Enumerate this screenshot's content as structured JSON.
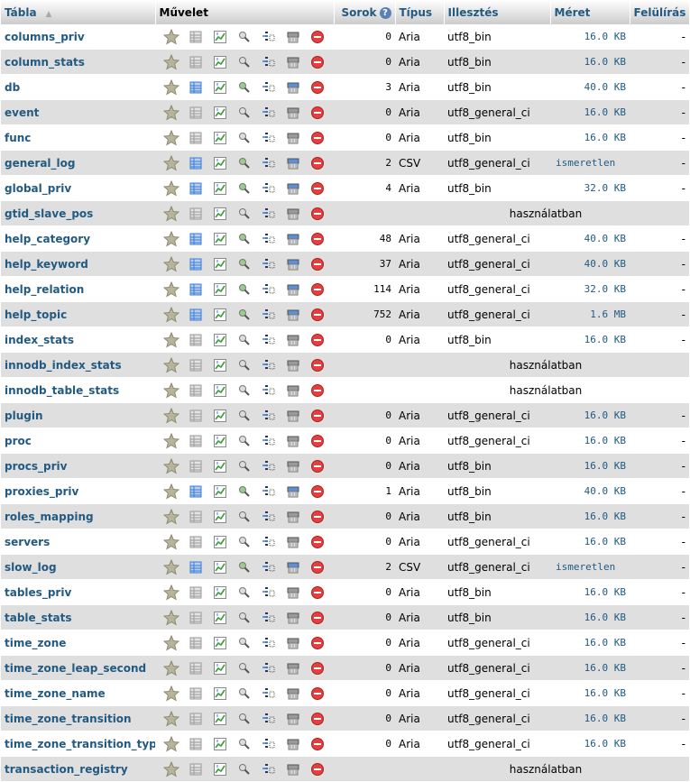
{
  "header": {
    "table": "Tábla",
    "action": "Művelet",
    "rows": "Sorok",
    "type": "Típus",
    "collation": "Illesztés",
    "size": "Méret",
    "overhead": "Felülírás"
  },
  "rows": [
    {
      "name": "columns_priv",
      "active": false,
      "rows": "0",
      "type": "Aria",
      "collation": "utf8_bin",
      "size": "16.0 KB",
      "overhead": "-"
    },
    {
      "name": "column_stats",
      "active": false,
      "rows": "0",
      "type": "Aria",
      "collation": "utf8_bin",
      "size": "16.0 KB",
      "overhead": "-"
    },
    {
      "name": "db",
      "active": true,
      "rows": "3",
      "type": "Aria",
      "collation": "utf8_bin",
      "size": "40.0 KB",
      "overhead": "-"
    },
    {
      "name": "event",
      "active": false,
      "rows": "0",
      "type": "Aria",
      "collation": "utf8_general_ci",
      "size": "16.0 KB",
      "overhead": "-"
    },
    {
      "name": "func",
      "active": false,
      "rows": "0",
      "type": "Aria",
      "collation": "utf8_bin",
      "size": "16.0 KB",
      "overhead": "-"
    },
    {
      "name": "general_log",
      "active": true,
      "rows": "2",
      "type": "CSV",
      "collation": "utf8_general_ci",
      "size": "ismeretlen",
      "overhead": "-"
    },
    {
      "name": "global_priv",
      "active": true,
      "rows": "4",
      "type": "Aria",
      "collation": "utf8_bin",
      "size": "32.0 KB",
      "overhead": "-"
    },
    {
      "name": "gtid_slave_pos",
      "active": false,
      "inuse": "használatban"
    },
    {
      "name": "help_category",
      "active": true,
      "rows": "48",
      "type": "Aria",
      "collation": "utf8_general_ci",
      "size": "40.0 KB",
      "overhead": "-"
    },
    {
      "name": "help_keyword",
      "active": true,
      "rows": "37",
      "type": "Aria",
      "collation": "utf8_general_ci",
      "size": "40.0 KB",
      "overhead": "-"
    },
    {
      "name": "help_relation",
      "active": true,
      "rows": "114",
      "type": "Aria",
      "collation": "utf8_general_ci",
      "size": "32.0 KB",
      "overhead": "-"
    },
    {
      "name": "help_topic",
      "active": true,
      "rows": "752",
      "type": "Aria",
      "collation": "utf8_general_ci",
      "size": "1.6 MB",
      "overhead": "-"
    },
    {
      "name": "index_stats",
      "active": false,
      "rows": "0",
      "type": "Aria",
      "collation": "utf8_bin",
      "size": "16.0 KB",
      "overhead": "-"
    },
    {
      "name": "innodb_index_stats",
      "active": false,
      "inuse": "használatban"
    },
    {
      "name": "innodb_table_stats",
      "active": false,
      "inuse": "használatban"
    },
    {
      "name": "plugin",
      "active": false,
      "rows": "0",
      "type": "Aria",
      "collation": "utf8_general_ci",
      "size": "16.0 KB",
      "overhead": "-"
    },
    {
      "name": "proc",
      "active": false,
      "rows": "0",
      "type": "Aria",
      "collation": "utf8_general_ci",
      "size": "16.0 KB",
      "overhead": "-"
    },
    {
      "name": "procs_priv",
      "active": false,
      "rows": "0",
      "type": "Aria",
      "collation": "utf8_bin",
      "size": "16.0 KB",
      "overhead": "-"
    },
    {
      "name": "proxies_priv",
      "active": true,
      "rows": "1",
      "type": "Aria",
      "collation": "utf8_bin",
      "size": "40.0 KB",
      "overhead": "-"
    },
    {
      "name": "roles_mapping",
      "active": false,
      "rows": "0",
      "type": "Aria",
      "collation": "utf8_bin",
      "size": "16.0 KB",
      "overhead": "-"
    },
    {
      "name": "servers",
      "active": false,
      "rows": "0",
      "type": "Aria",
      "collation": "utf8_general_ci",
      "size": "16.0 KB",
      "overhead": "-"
    },
    {
      "name": "slow_log",
      "active": true,
      "rows": "2",
      "type": "CSV",
      "collation": "utf8_general_ci",
      "size": "ismeretlen",
      "overhead": "-"
    },
    {
      "name": "tables_priv",
      "active": false,
      "rows": "0",
      "type": "Aria",
      "collation": "utf8_bin",
      "size": "16.0 KB",
      "overhead": "-"
    },
    {
      "name": "table_stats",
      "active": false,
      "rows": "0",
      "type": "Aria",
      "collation": "utf8_bin",
      "size": "16.0 KB",
      "overhead": "-"
    },
    {
      "name": "time_zone",
      "active": false,
      "rows": "0",
      "type": "Aria",
      "collation": "utf8_general_ci",
      "size": "16.0 KB",
      "overhead": "-"
    },
    {
      "name": "time_zone_leap_second",
      "active": false,
      "rows": "0",
      "type": "Aria",
      "collation": "utf8_general_ci",
      "size": "16.0 KB",
      "overhead": "-"
    },
    {
      "name": "time_zone_name",
      "active": false,
      "rows": "0",
      "type": "Aria",
      "collation": "utf8_general_ci",
      "size": "16.0 KB",
      "overhead": "-"
    },
    {
      "name": "time_zone_transition",
      "active": false,
      "rows": "0",
      "type": "Aria",
      "collation": "utf8_general_ci",
      "size": "16.0 KB",
      "overhead": "-"
    },
    {
      "name": "time_zone_transition_type",
      "active": false,
      "rows": "0",
      "type": "Aria",
      "collation": "utf8_general_ci",
      "size": "16.0 KB",
      "overhead": "-"
    },
    {
      "name": "transaction_registry",
      "active": false,
      "inuse": "használatban"
    }
  ],
  "icons": [
    "favorite-star-icon",
    "browse-icon",
    "structure-icon",
    "search-icon",
    "insert-icon",
    "empty-icon",
    "drop-icon"
  ],
  "colors": {
    "link": "#235a81",
    "row_alt": "#dfdfdf",
    "drop": "#e04040"
  }
}
